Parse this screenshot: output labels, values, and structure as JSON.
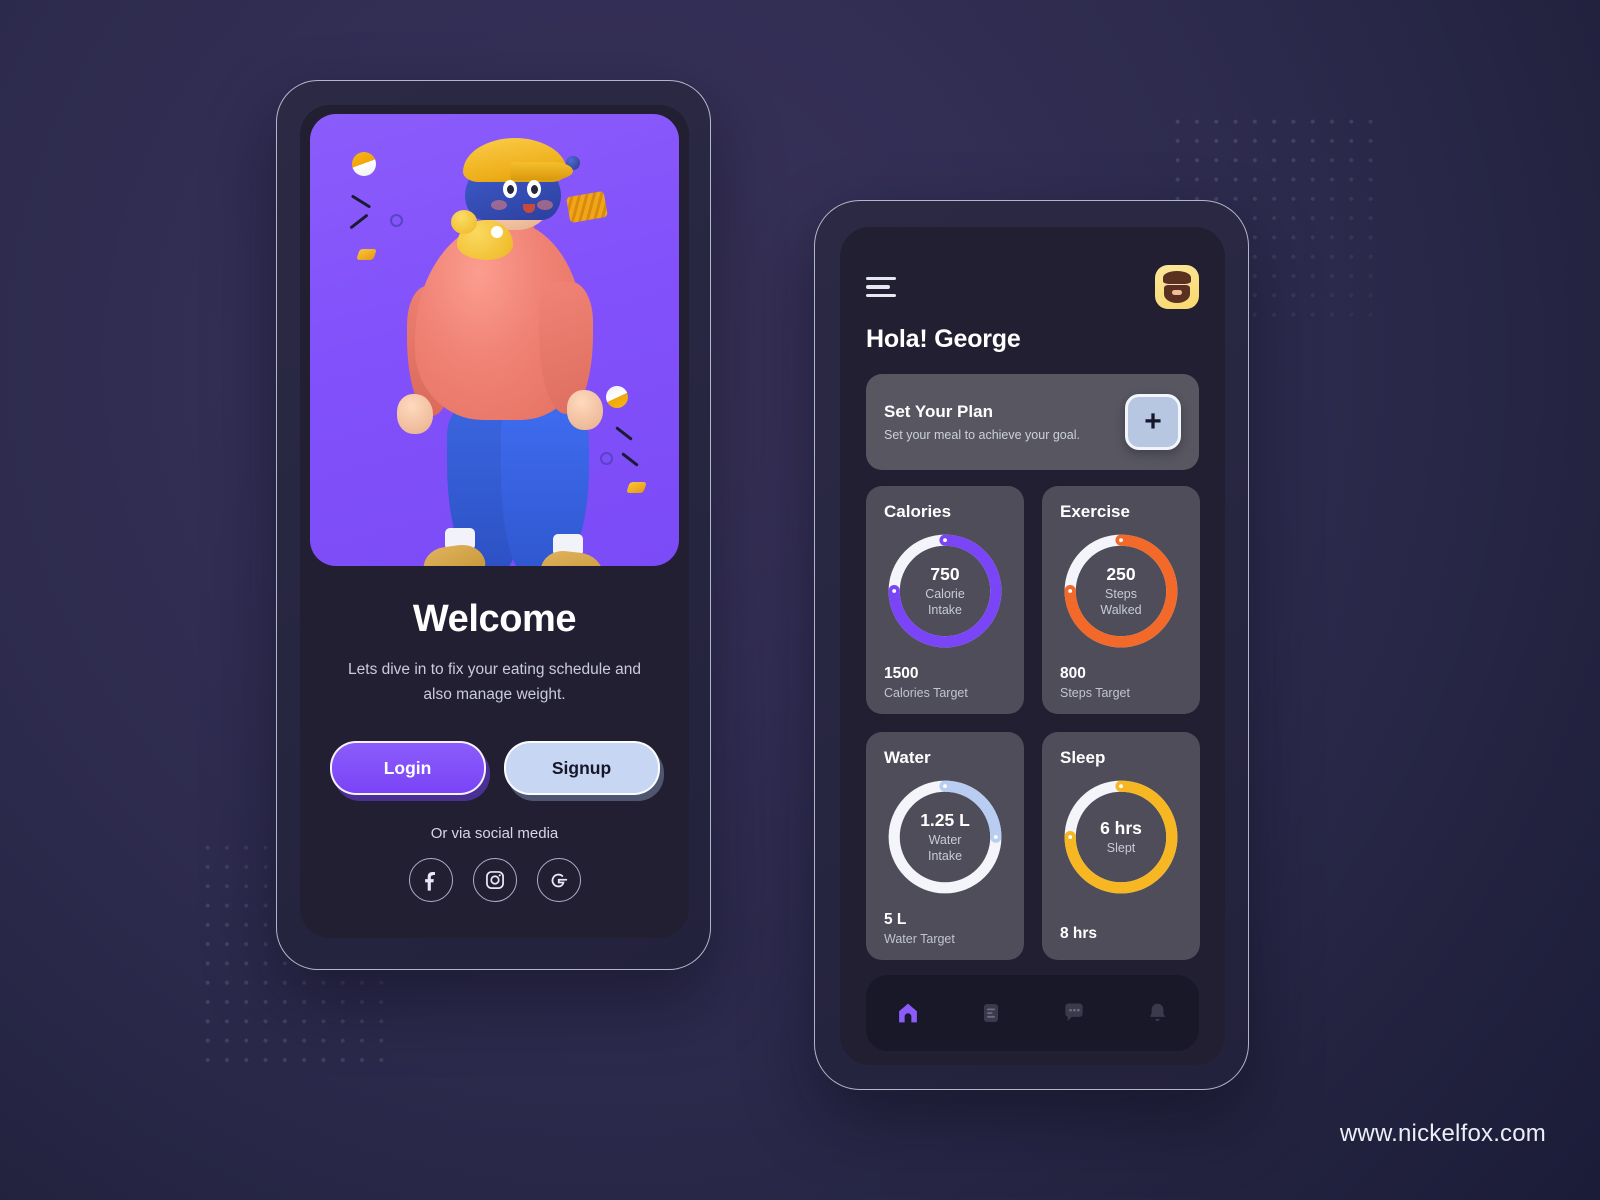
{
  "colors": {
    "page_background": "#2f2b50",
    "page_background_dark": "#1b1c38",
    "accent_purple": "#7a44f7",
    "accent_orange": "#f2692a",
    "accent_blue": "#b9ccf2",
    "accent_yellow": "#f7b723",
    "card_surface": "#4e4d59",
    "plan_surface": "#575661",
    "screen_surface": "#211f31",
    "hero_purple": "#8251fb",
    "signup_blue": "#c7d6f2",
    "avatar_yellow": "#f8d86e"
  },
  "onboarding": {
    "hero": {
      "alt": "3d-walking-character-illustration",
      "character": {
        "cap_color": "#eeae19",
        "hair_color": "#2d3f9e",
        "sweater_color": "#f08375",
        "pants_color": "#3060e0",
        "boots_color": "#c59434",
        "bird_color": "#eeb622"
      }
    },
    "title": "Welcome",
    "subtitle": "Lets dive in  to fix your eating schedule and also manage weight.",
    "buttons": {
      "login": "Login",
      "signup": "Signup"
    },
    "social_label": "Or via social media",
    "social": [
      {
        "name": "facebook-icon",
        "glyph": "f"
      },
      {
        "name": "instagram-icon",
        "glyph": ""
      },
      {
        "name": "google-icon",
        "glyph": "G"
      }
    ]
  },
  "dashboard": {
    "menu_icon": "hamburger-menu-icon",
    "avatar": "user-avatar-bearded-man",
    "greeting": "Hola! George",
    "plan": {
      "title": "Set Your Plan",
      "subtitle": "Set your meal to achieve your goal.",
      "add_label": "+"
    },
    "stats": [
      {
        "title": "Calories",
        "ring_value": "750",
        "ring_label": "Calorie Intake",
        "ring_label_line1": "Calorie",
        "ring_label_line2": "Intake",
        "progress_percent": 75,
        "color": "#7a44f7",
        "track_color": "#f4f5fa",
        "target_value": "1500",
        "target_label": "Calories Target"
      },
      {
        "title": "Exercise",
        "ring_value": "250",
        "ring_label": "Steps Walked",
        "ring_label_line1": "Steps",
        "ring_label_line2": "Walked",
        "progress_percent": 75,
        "color": "#f2692a",
        "track_color": "#f4f5fa",
        "target_value": "800",
        "target_label": "Steps Target"
      },
      {
        "title": "Water",
        "ring_value": "1.25 L",
        "ring_label": "Water Intake",
        "ring_label_line1": "Water",
        "ring_label_line2": "Intake",
        "progress_percent": 25,
        "color": "#b9ccf2",
        "track_color": "#f4f5fa",
        "target_value": "5 L",
        "target_label": "Water Target"
      },
      {
        "title": "Sleep",
        "ring_value": "6 hrs",
        "ring_label": "Slept",
        "ring_label_line1": "Slept",
        "ring_label_line2": "",
        "progress_percent": 75,
        "color": "#f7b723",
        "track_color": "#f4f5fa",
        "target_value": "8 hrs",
        "target_label": ""
      }
    ],
    "bottom_nav": [
      {
        "name": "home-icon",
        "active": true
      },
      {
        "name": "document-icon",
        "active": false
      },
      {
        "name": "chat-icon",
        "active": false
      },
      {
        "name": "bell-icon",
        "active": false
      }
    ]
  },
  "footer": {
    "url": "www.nickelfox.com"
  }
}
